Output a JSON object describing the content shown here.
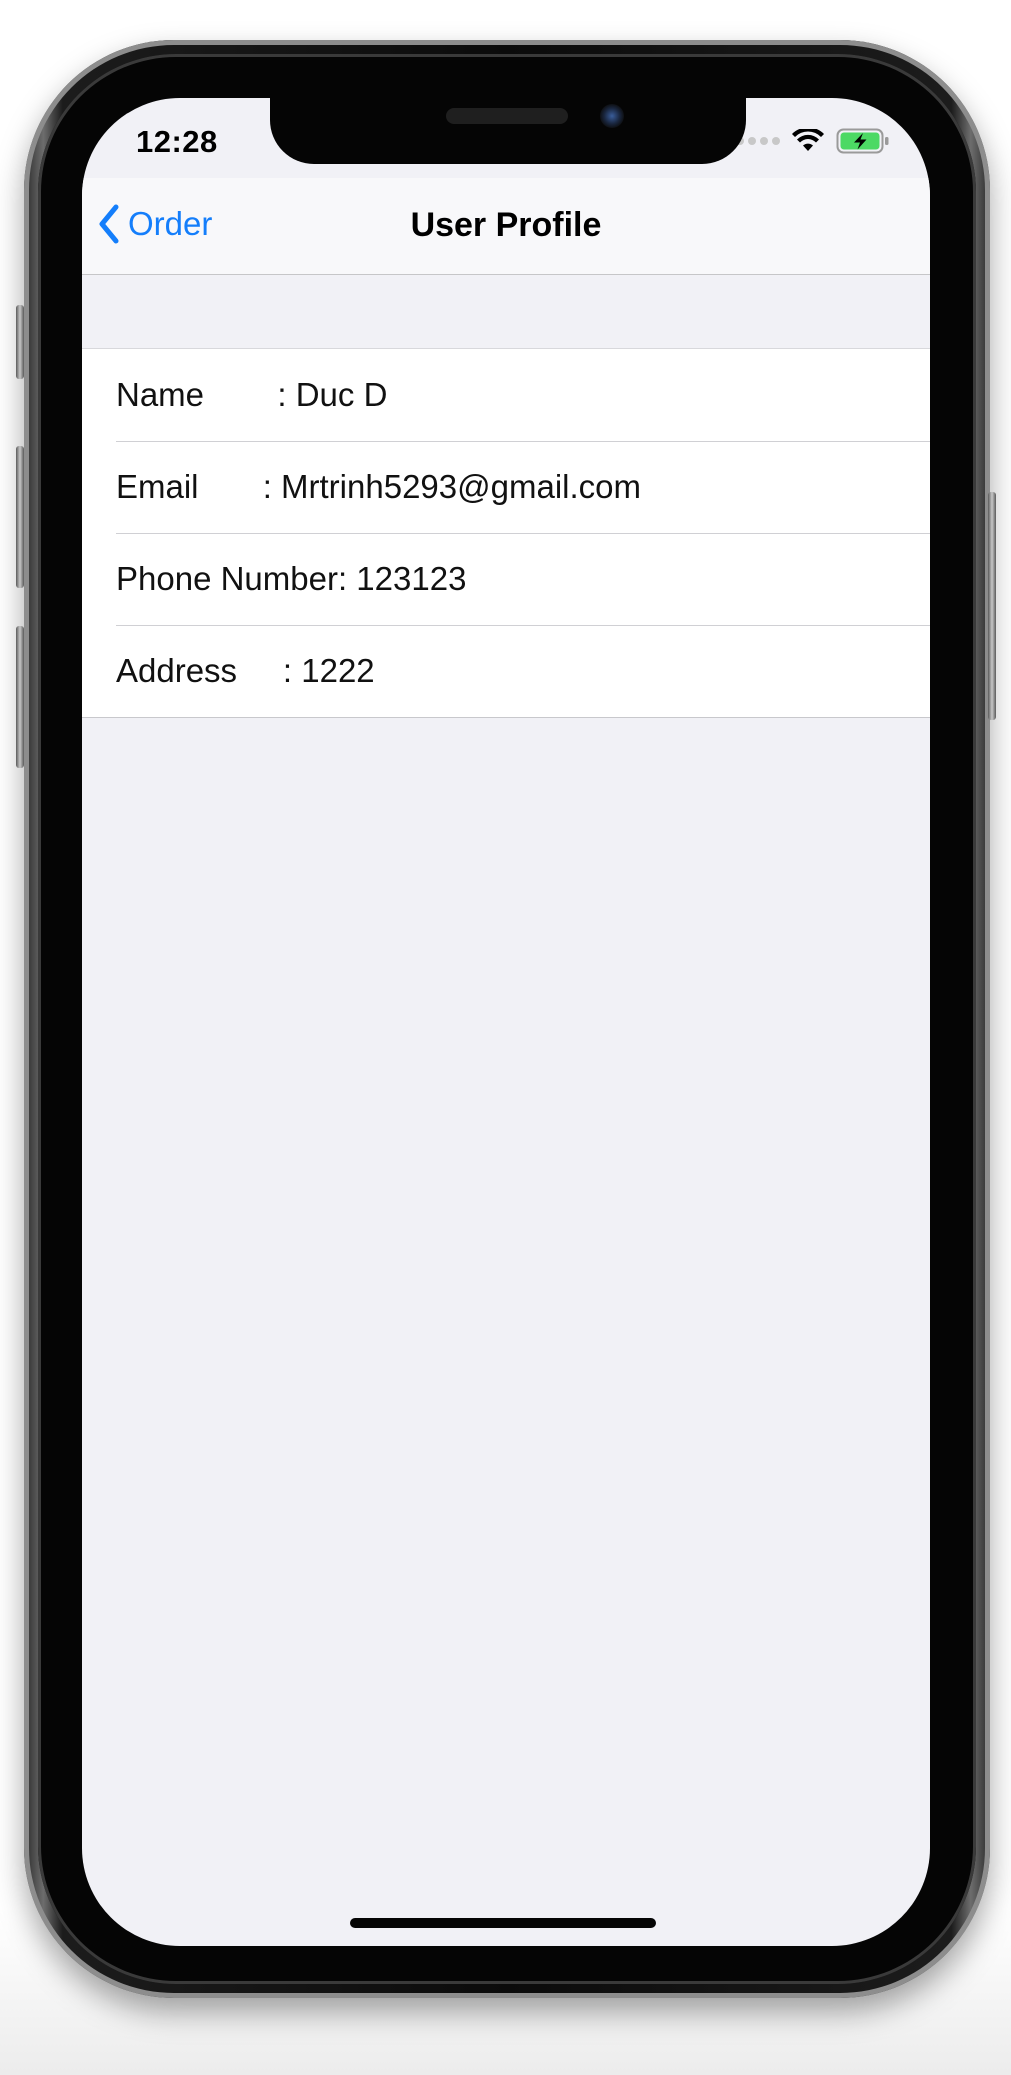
{
  "status_bar": {
    "time": "12:28",
    "icons": [
      "signal-dots-icon",
      "wifi-icon",
      "battery-charging-icon"
    ],
    "battery_color": "#4cd964"
  },
  "nav_bar": {
    "back_label": "Order",
    "title": "User Profile",
    "accent_color": "#147efb"
  },
  "profile_rows": [
    {
      "label": "Name        ",
      "value": ": Duc D"
    },
    {
      "label": "Email       ",
      "value": ": Mrtrinh5293@gmail.com"
    },
    {
      "label": "Phone Number",
      "value": ": 123123"
    },
    {
      "label": "Address     ",
      "value": ": 1222"
    }
  ]
}
